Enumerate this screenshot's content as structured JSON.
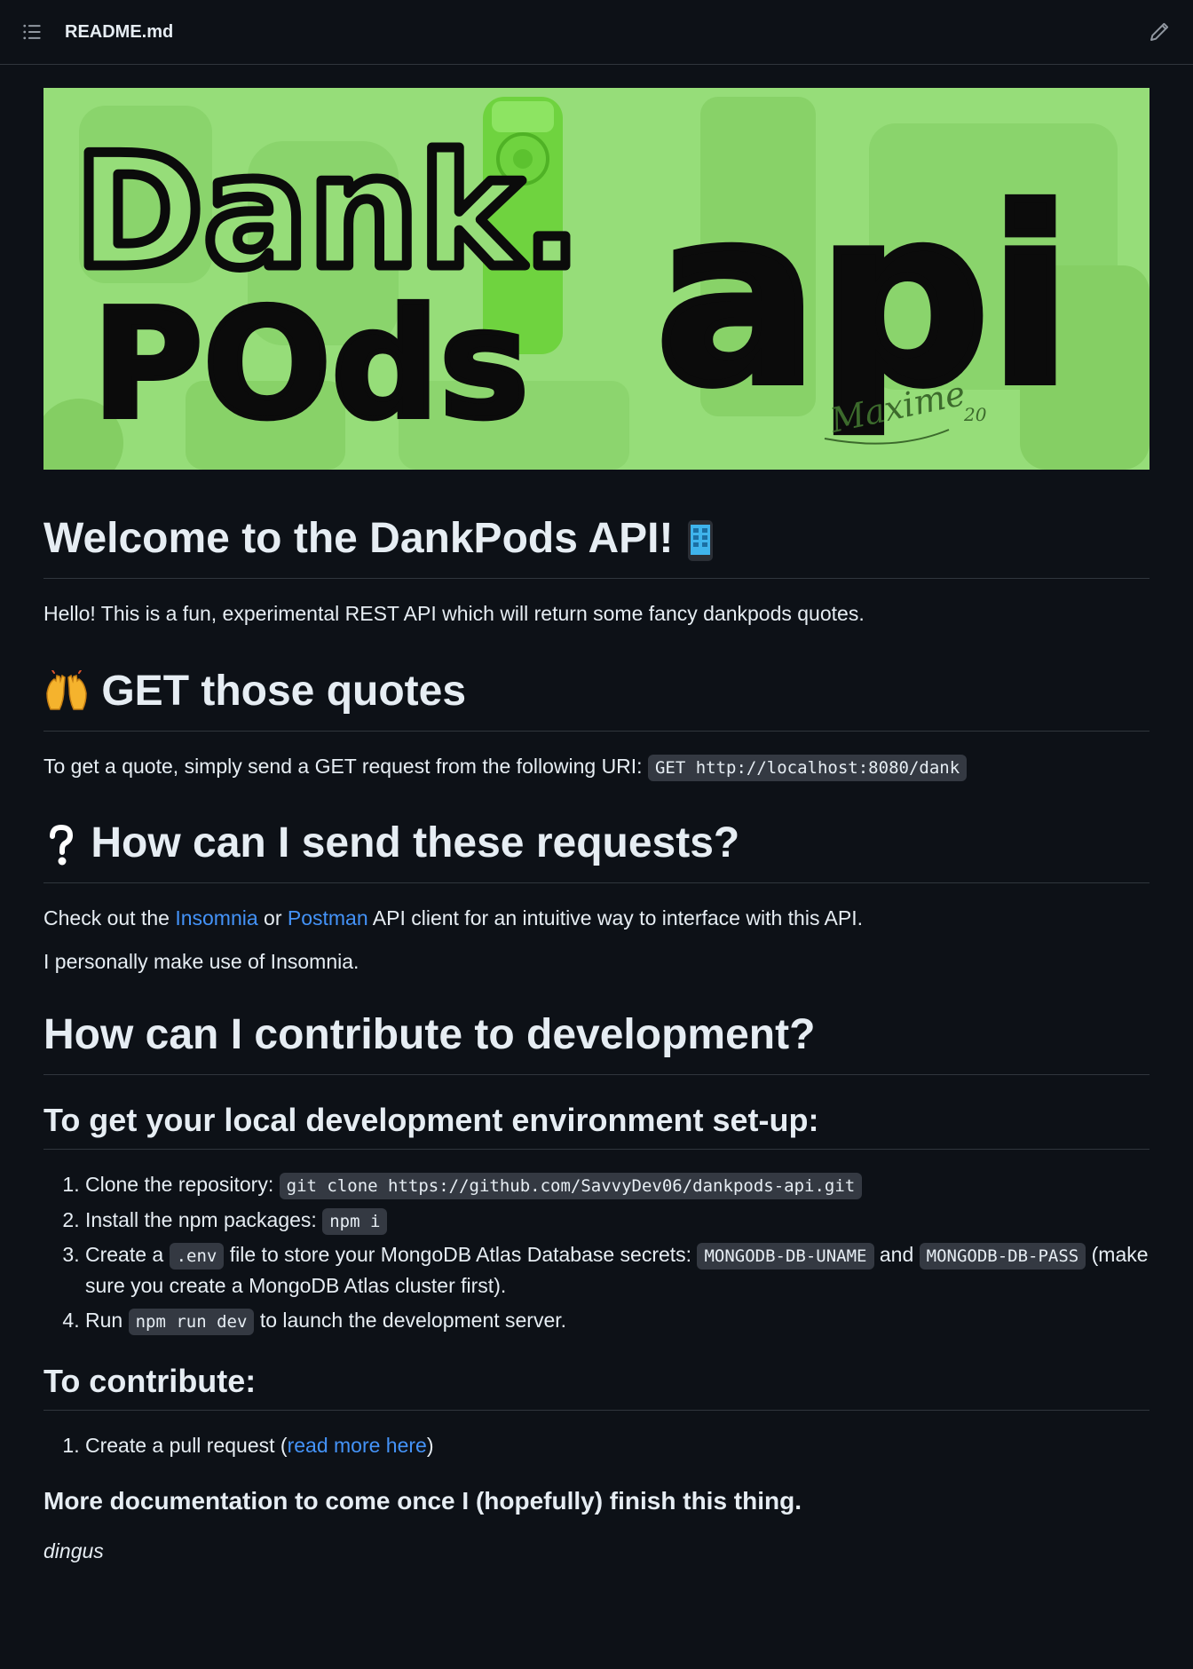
{
  "header": {
    "file_name": "README.md",
    "list_icon": "list-icon",
    "edit_icon": "pencil-icon"
  },
  "banner": {
    "line1": "Dank.",
    "line2": "POds",
    "line3": "api",
    "signature": "Maxime",
    "signature_year": "20",
    "colors": {
      "background": "#96dd79",
      "ipod": "#6fd33f",
      "ink": "#0b0b0b"
    }
  },
  "welcome": {
    "title": "Welcome to the DankPods API!",
    "title_icon": "mobile-phone-icon",
    "intro": "Hello! This is a fun, experimental REST API which will return some fancy dankpods quotes."
  },
  "get_section": {
    "title_icon": "raised-hands-icon",
    "title": "GET those quotes",
    "text": "To get a quote, simply send a GET request from the following URI:",
    "code": "GET http://localhost:8080/dank"
  },
  "how_section": {
    "title_icon": "question-mark-icon",
    "title": "How can I send these requests?",
    "text_before": "Check out the",
    "link1": "Insomnia",
    "text_or": "or",
    "link2": "Postman",
    "text_after": "API client for an intuitive way to interface with this API.",
    "personal": "I personally make use of Insomnia."
  },
  "contribute_section": {
    "title": "How can I contribute to development?",
    "setup_title": "To get your local development environment set-up:",
    "steps": {
      "s1_text": "Clone the repository:",
      "s1_code": "git clone https://github.com/SavvyDev06/dankpods-api.git",
      "s2_text": "Install the npm packages:",
      "s2_code": "npm i",
      "s3_text1": "Create a",
      "s3_code1": ".env",
      "s3_text2": "file to store your MongoDB Atlas Database secrets:",
      "s3_code2": "MONGODB-DB-UNAME",
      "s3_text3": "and",
      "s3_code3": "MONGODB-DB-PASS",
      "s3_text4": "(make sure you create a MongoDB Atlas cluster first).",
      "s4_text1": "Run",
      "s4_code": "npm run dev",
      "s4_text2": "to launch the development server."
    },
    "contribute_title": "To contribute:",
    "pr_text": "Create a pull request (",
    "pr_link": "read more here",
    "pr_close": ")",
    "more_docs": "More documentation to come once I (hopefully) finish this thing.",
    "signoff": "dingus"
  }
}
